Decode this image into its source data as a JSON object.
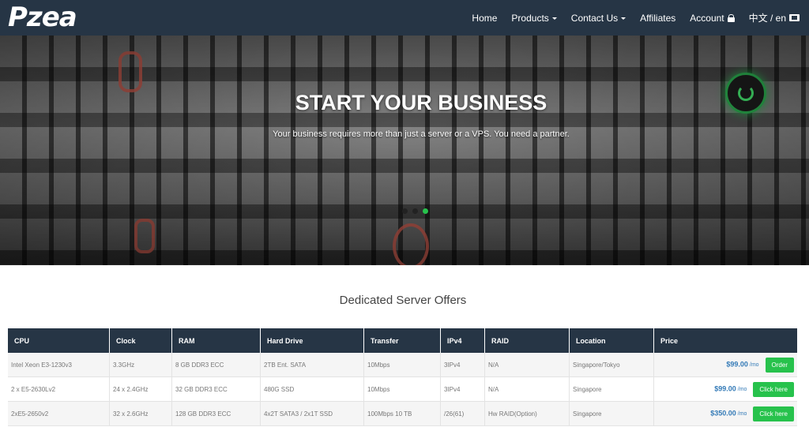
{
  "logo": "Pzea",
  "nav": {
    "home": "Home",
    "products": "Products",
    "contact": "Contact Us",
    "affiliates": "Affiliates",
    "account": "Account",
    "language": "中文 / en"
  },
  "hero": {
    "title": "START YOUR BUSINESS",
    "subtitle": "Your business requires more than just a server or a VPS. You need a partner.",
    "slides": 3,
    "active_slide": 3
  },
  "offers": {
    "title": "Dedicated Server Offers",
    "columns": [
      "CPU",
      "Clock",
      "RAM",
      "Hard Drive",
      "Transfer",
      "IPv4",
      "RAID",
      "Location",
      "Price"
    ],
    "rows": [
      {
        "cpu": "Intel Xeon E3-1230v3",
        "clock": "3.3GHz",
        "ram": "8 GB DDR3 ECC",
        "hdd": "2TB Ent. SATA",
        "transfer": "10Mbps",
        "ipv4": "3IPv4",
        "raid": "N/A",
        "location": "Singapore/Tokyo",
        "price": "$99.00",
        "per": "/mo",
        "button": "Order"
      },
      {
        "cpu": "2 x E5-2630Lv2",
        "clock": "24 x 2.4GHz",
        "ram": "32 GB DDR3 ECC",
        "hdd": "480G SSD",
        "transfer": "10Mbps",
        "ipv4": "3IPv4",
        "raid": "N/A",
        "location": "Singapore",
        "price": "$99.00",
        "per": "/mo",
        "button": "Click here"
      },
      {
        "cpu": "2xE5-2650v2",
        "clock": "32 x 2.6GHz",
        "ram": "128 GB DDR3 ECC",
        "hdd": "4x2T SATA3 / 2x1T SSD",
        "transfer": "100Mbps 10 TB",
        "ipv4": "/26(61)",
        "raid": "Hw RAID(Option)",
        "location": "Singapore",
        "price": "$350.00",
        "per": "/mo",
        "button": "Click here"
      }
    ]
  },
  "colors": {
    "navbar": "#263545",
    "accent_green": "#27c24c",
    "price_blue": "#337ab7"
  }
}
